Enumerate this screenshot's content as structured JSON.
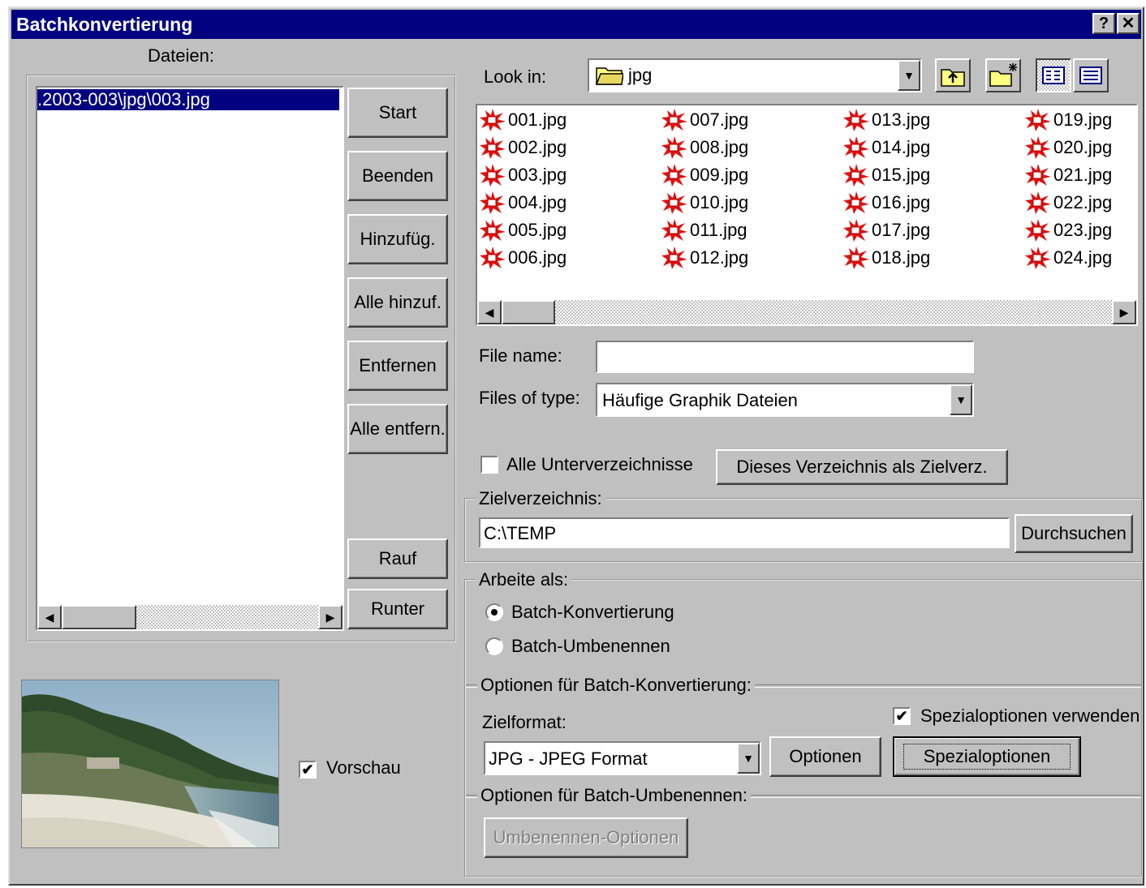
{
  "window": {
    "title": "Batchkonvertierung",
    "help_btn": "?",
    "close_btn": "✕"
  },
  "left": {
    "files_label": "Dateien:",
    "selected_file": ".2003-003\\jpg\\003.jpg",
    "buttons": {
      "start": "Start",
      "beenden": "Beenden",
      "hinzufueg": "Hinzufüg.",
      "alle_hinzuf": "Alle hinzuf.",
      "entfernen": "Entfernen",
      "alle_entfern": "Alle entfern.",
      "rauf": "Rauf",
      "runter": "Runter"
    },
    "preview_label": "Vorschau",
    "preview_checked": true
  },
  "browser": {
    "look_in_label": "Look in:",
    "look_in_value": "jpg",
    "files": [
      "001.jpg",
      "002.jpg",
      "003.jpg",
      "004.jpg",
      "005.jpg",
      "006.jpg",
      "007.jpg",
      "008.jpg",
      "009.jpg",
      "010.jpg",
      "011.jpg",
      "012.jpg",
      "013.jpg",
      "014.jpg",
      "015.jpg",
      "016.jpg",
      "017.jpg",
      "018.jpg",
      "019.jpg",
      "020.jpg",
      "021.jpg",
      "022.jpg",
      "023.jpg",
      "024.jpg"
    ],
    "file_name_label": "File name:",
    "file_name_value": "",
    "files_of_type_label": "Files of type:",
    "files_of_type_value": "Häufige Graphik Dateien"
  },
  "options": {
    "subdirs_label": "Alle Unterverzeichnisse",
    "subdirs_checked": false,
    "set_target_btn": "Dieses Verzeichnis als Zielverz.",
    "target_group": "Zielverzeichnis:",
    "target_value": "C:\\TEMP",
    "browse_btn": "Durchsuchen",
    "mode_group": "Arbeite als:",
    "mode_convert": "Batch-Konvertierung",
    "mode_rename": "Batch-Umbenennen",
    "convert_group": "Optionen für Batch-Konvertierung:",
    "format_label": "Zielformat:",
    "format_value": "JPG - JPEG Format",
    "options_btn": "Optionen",
    "special_checkbox": "Spezialoptionen verwenden",
    "special_checked": true,
    "special_btn": "Spezialoptionen",
    "rename_group": "Optionen für Batch-Umbenennen:",
    "rename_btn": "Umbenennen-Optionen"
  },
  "colors": {
    "face": "#c0c0c0",
    "title_bg": "#000080",
    "selection": "#000080",
    "file_icon": "#e01010"
  },
  "icons": {
    "folder": "folder-icon",
    "up": "up-folder-icon",
    "new_folder": "new-folder-icon",
    "list": "list-view-icon",
    "details": "details-view-icon",
    "file": "image-file-icon"
  }
}
